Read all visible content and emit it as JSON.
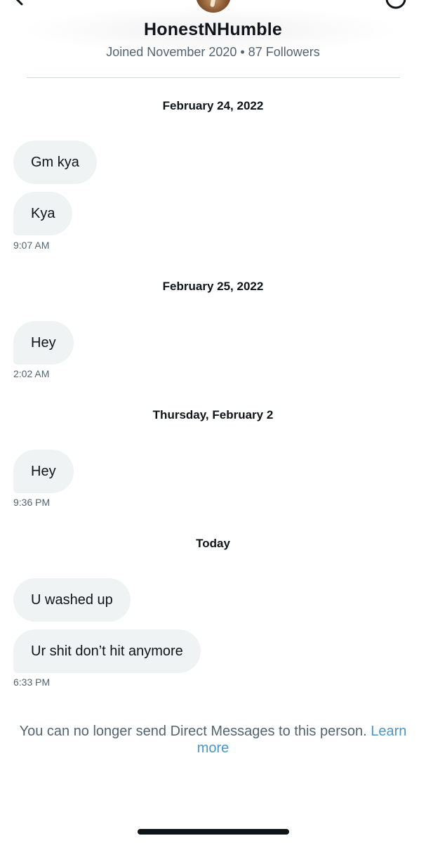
{
  "profile": {
    "name": "HonestNHumble",
    "meta": "Joined November 2020 • 87 Followers"
  },
  "conversation": {
    "groups": [
      {
        "date": "February 24, 2022",
        "messages": [
          "Gm kya",
          "Kya"
        ],
        "time": "9:07 AM"
      },
      {
        "date": "February 25, 2022",
        "messages": [
          "Hey"
        ],
        "time": "2:02 AM"
      },
      {
        "date": "Thursday, February 2",
        "messages": [
          "Hey"
        ],
        "time": "9:36 PM"
      },
      {
        "date": "Today",
        "messages": [
          "U washed up",
          "Ur shit don’t hit anymore"
        ],
        "time": "6:33 PM"
      }
    ]
  },
  "notice": {
    "text": "You can no longer send Direct Messages to this person.",
    "link": "Learn more"
  },
  "colors": {
    "bubble_bg": "#eff3f4",
    "secondary_text": "#536471",
    "link": "#4a95c7"
  }
}
